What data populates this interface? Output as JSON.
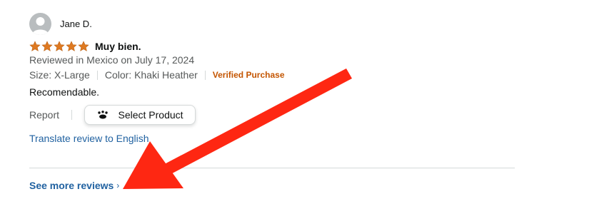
{
  "review": {
    "profile_name": "Jane D.",
    "rating": 5,
    "title": "Muy bien.",
    "date_line": "Reviewed in Mexico on July 17, 2024",
    "size_label": "Size: X-Large",
    "color_label": "Color: Khaki Heather",
    "verified_label": "Verified Purchase",
    "body": "Recomendable.",
    "report_label": "Report",
    "select_product_label": "Select Product",
    "translate_label": "Translate review to English"
  },
  "footer": {
    "see_more_label": "See more reviews",
    "see_more_chevron": "›"
  },
  "colors": {
    "star": "#de7921",
    "verified": "#c45500",
    "link": "#2162a1",
    "annotation_arrow": "#fe2712"
  },
  "icons": {
    "avatar": "user-avatar-icon",
    "star": "star-icon",
    "select_product": "paw-icon",
    "chevron": "chevron-right-icon",
    "annotation": "red-arrow-annotation"
  }
}
